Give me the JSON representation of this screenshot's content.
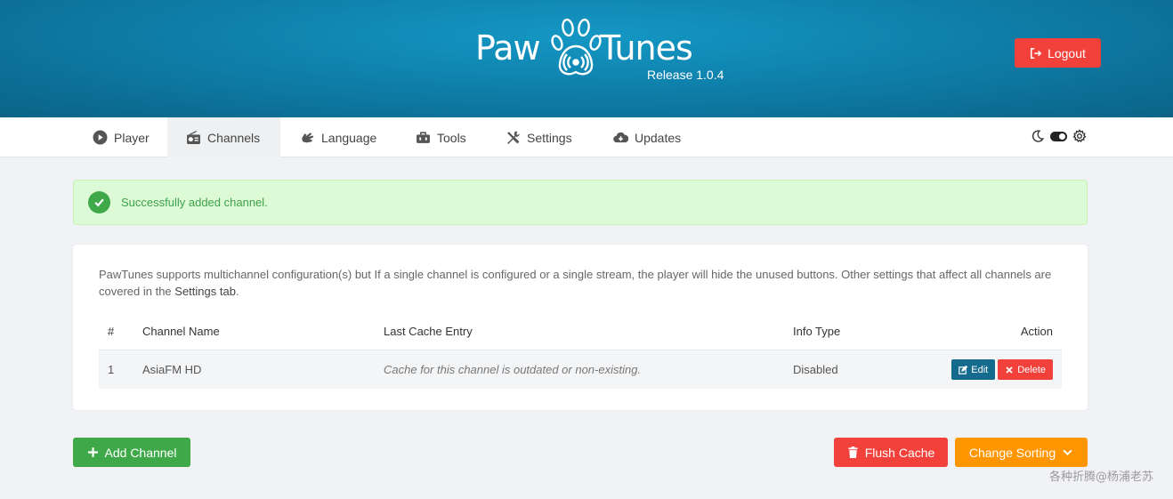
{
  "header": {
    "logo_word_1": "Paw",
    "logo_word_2": "Tunes",
    "release": "Release 1.0.4",
    "logout_label": "Logout"
  },
  "nav": {
    "items": [
      {
        "label": "Player",
        "icon": "play-circle-icon"
      },
      {
        "label": "Channels",
        "icon": "radio-icon",
        "active": true
      },
      {
        "label": "Language",
        "icon": "sign-language-icon"
      },
      {
        "label": "Tools",
        "icon": "toolbox-icon"
      },
      {
        "label": "Settings",
        "icon": "tools-icon"
      },
      {
        "label": "Updates",
        "icon": "cloud-download-icon"
      }
    ],
    "theme_toggle": {
      "left_icon": "moon-icon",
      "right_icon": "gear-icon",
      "state": "dark"
    }
  },
  "alert": {
    "message": "Successfully added channel.",
    "color": "#3fa14a"
  },
  "card": {
    "description_part1": "PawTunes supports multichannel configuration(s) but If a single channel is configured or a single stream, the player will hide the unused buttons. Other settings that affect all channels are covered in the ",
    "description_link": "Settings tab",
    "description_part2": ".",
    "table": {
      "headers": [
        "#",
        "Channel Name",
        "Last Cache Entry",
        "Info Type",
        "Action"
      ],
      "rows": [
        {
          "num": "1",
          "name": "AsiaFM HD",
          "cache": "Cache for this channel is outdated or non-existing.",
          "info_type": "Disabled",
          "edit_label": "Edit",
          "delete_label": "Delete"
        }
      ]
    }
  },
  "buttons": {
    "add_channel": "Add Channel",
    "flush_cache": "Flush Cache",
    "change_sorting": "Change Sorting"
  },
  "watermark": "各种折腾@杨浦老苏",
  "colors": {
    "danger": "#f2413a",
    "success": "#3fa94a",
    "warning": "#ff9500",
    "primary": "#146b8e"
  }
}
